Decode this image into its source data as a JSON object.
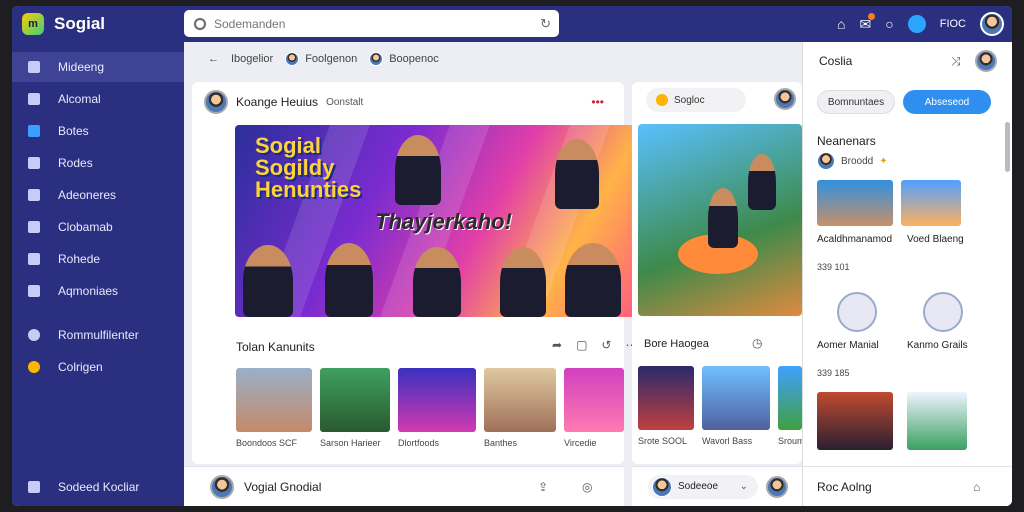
{
  "app": {
    "name": "Sogial",
    "logo_text": "m"
  },
  "search": {
    "placeholder": "Sodemanden"
  },
  "topbar": {
    "counter": "FIOC"
  },
  "sidebar": {
    "items": [
      {
        "label": "Mideeng"
      },
      {
        "label": "Alcomal"
      },
      {
        "label": "Botes"
      },
      {
        "label": "Rodes"
      },
      {
        "label": "Adeoneres"
      },
      {
        "label": "Clobamab"
      },
      {
        "label": "Rohede"
      },
      {
        "label": "Aqmoniaes"
      },
      {
        "label": "Rommulfilenter"
      },
      {
        "label": "Colrigen"
      }
    ],
    "footer": "Sodeed Kocliar"
  },
  "breadcrumb": {
    "items": [
      "Ibogelior",
      "Foolgenon",
      "Boopenoc"
    ]
  },
  "post": {
    "author": "Koange Heuius",
    "group": "Oonstalt",
    "banner_title": "Sogial Sogildy Henunties",
    "banner_script": "Thayjerkaho!",
    "section": "Tolan Kanunits",
    "thumbs": [
      "Boondoos SCF",
      "Sarson Harieer",
      "Dlortfoods",
      "Banthes",
      "Vircedie"
    ]
  },
  "side_post": {
    "chip": "Sogloc",
    "section": "Bore Haogea",
    "thumbs": [
      "Srote SOOL",
      "Wavorl Bass",
      "Sroum"
    ]
  },
  "right_panel": {
    "title": "Coslia",
    "btn_secondary": "Bomnuntaes",
    "btn_primary": "Abseseod",
    "heading": "Neanenars",
    "subtext": "Broodd",
    "cards": [
      {
        "label": "Acaldhmanamod",
        "meta": "339 101"
      },
      {
        "label": "Voed Blaeng",
        "meta": ""
      },
      {
        "label": "Aomer Manial",
        "meta": "339 185"
      },
      {
        "label": "Kanmo Grails",
        "meta": ""
      }
    ]
  },
  "bottom": {
    "left_label": "Vogial Gnodial",
    "mid_label": "Sodeeoe",
    "right_label": "Roc Aolng"
  },
  "colors": {
    "sidebar": "#2b2f80",
    "accent": "#2f8ff0",
    "badge": "#ff7a1a"
  }
}
